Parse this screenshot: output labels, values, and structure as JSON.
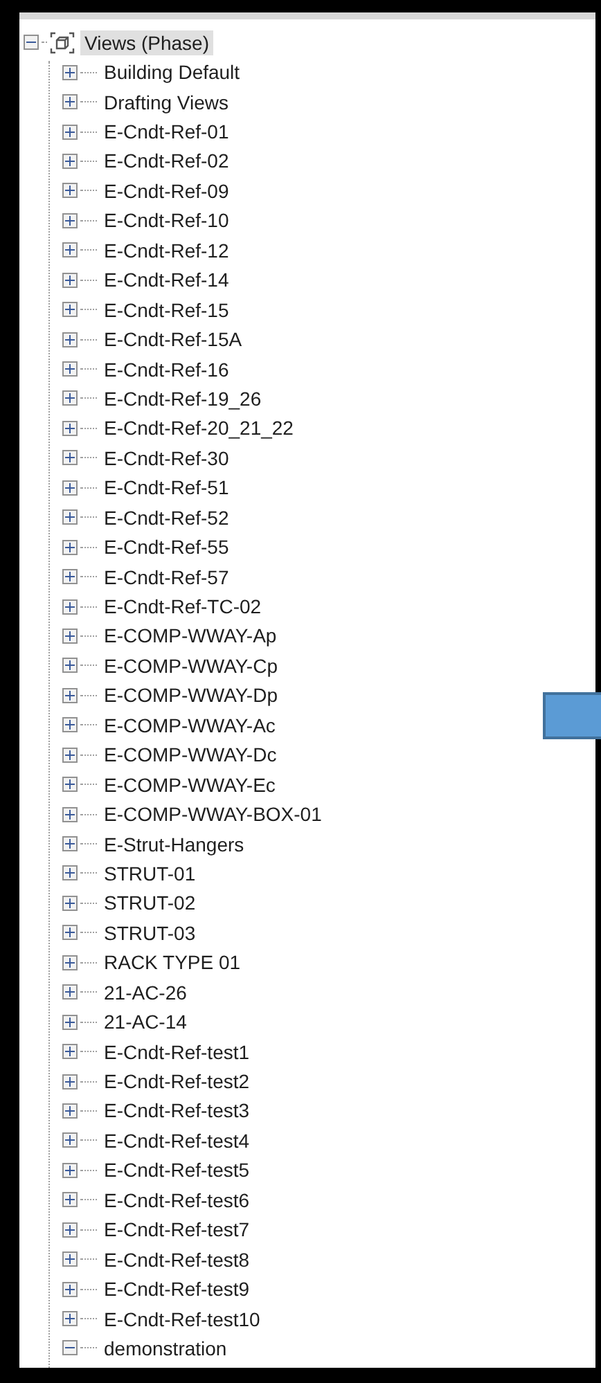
{
  "tree": {
    "label": "Views (Phase)",
    "expanded": true,
    "selected": true,
    "children": [
      {
        "label": "Building Default",
        "expanded": false,
        "selected": false
      },
      {
        "label": "Drafting Views",
        "expanded": false,
        "selected": false
      },
      {
        "label": "E-Cndt-Ref-01",
        "expanded": false,
        "selected": false
      },
      {
        "label": "E-Cndt-Ref-02",
        "expanded": false,
        "selected": false
      },
      {
        "label": "E-Cndt-Ref-09",
        "expanded": false,
        "selected": false
      },
      {
        "label": "E-Cndt-Ref-10",
        "expanded": false,
        "selected": false
      },
      {
        "label": "E-Cndt-Ref-12",
        "expanded": false,
        "selected": false
      },
      {
        "label": "E-Cndt-Ref-14",
        "expanded": false,
        "selected": false
      },
      {
        "label": "E-Cndt-Ref-15",
        "expanded": false,
        "selected": false
      },
      {
        "label": "E-Cndt-Ref-15A",
        "expanded": false,
        "selected": false
      },
      {
        "label": "E-Cndt-Ref-16",
        "expanded": false,
        "selected": false
      },
      {
        "label": "E-Cndt-Ref-19_26",
        "expanded": false,
        "selected": false
      },
      {
        "label": "E-Cndt-Ref-20_21_22",
        "expanded": false,
        "selected": false
      },
      {
        "label": "E-Cndt-Ref-30",
        "expanded": false,
        "selected": false
      },
      {
        "label": "E-Cndt-Ref-51",
        "expanded": false,
        "selected": false
      },
      {
        "label": "E-Cndt-Ref-52",
        "expanded": false,
        "selected": false
      },
      {
        "label": "E-Cndt-Ref-55",
        "expanded": false,
        "selected": false
      },
      {
        "label": "E-Cndt-Ref-57",
        "expanded": false,
        "selected": false
      },
      {
        "label": "E-Cndt-Ref-TC-02",
        "expanded": false,
        "selected": false
      },
      {
        "label": "E-COMP-WWAY-Ap",
        "expanded": false,
        "selected": false
      },
      {
        "label": "E-COMP-WWAY-Cp",
        "expanded": false,
        "selected": false
      },
      {
        "label": "E-COMP-WWAY-Dp",
        "expanded": false,
        "selected": false
      },
      {
        "label": "E-COMP-WWAY-Ac",
        "expanded": false,
        "selected": false
      },
      {
        "label": "E-COMP-WWAY-Dc",
        "expanded": false,
        "selected": false
      },
      {
        "label": "E-COMP-WWAY-Ec",
        "expanded": false,
        "selected": false
      },
      {
        "label": "E-COMP-WWAY-BOX-01",
        "expanded": false,
        "selected": false
      },
      {
        "label": "E-Strut-Hangers",
        "expanded": false,
        "selected": false
      },
      {
        "label": "STRUT-01",
        "expanded": false,
        "selected": false
      },
      {
        "label": "STRUT-02",
        "expanded": false,
        "selected": false
      },
      {
        "label": "STRUT-03",
        "expanded": false,
        "selected": false
      },
      {
        "label": "RACK TYPE 01",
        "expanded": false,
        "selected": false
      },
      {
        "label": "21-AC-26",
        "expanded": false,
        "selected": false
      },
      {
        "label": "21-AC-14",
        "expanded": false,
        "selected": false
      },
      {
        "label": "E-Cndt-Ref-test1",
        "expanded": false,
        "selected": false
      },
      {
        "label": "E-Cndt-Ref-test2",
        "expanded": false,
        "selected": false
      },
      {
        "label": "E-Cndt-Ref-test3",
        "expanded": false,
        "selected": false
      },
      {
        "label": "E-Cndt-Ref-test4",
        "expanded": false,
        "selected": false
      },
      {
        "label": "E-Cndt-Ref-test5",
        "expanded": false,
        "selected": false
      },
      {
        "label": "E-Cndt-Ref-test6",
        "expanded": false,
        "selected": false
      },
      {
        "label": "E-Cndt-Ref-test7",
        "expanded": false,
        "selected": false
      },
      {
        "label": "E-Cndt-Ref-test8",
        "expanded": false,
        "selected": false
      },
      {
        "label": "E-Cndt-Ref-test9",
        "expanded": false,
        "selected": false
      },
      {
        "label": "E-Cndt-Ref-test10",
        "expanded": false,
        "selected": false
      },
      {
        "label": "demonstration",
        "expanded": true,
        "selected": false
      }
    ]
  }
}
